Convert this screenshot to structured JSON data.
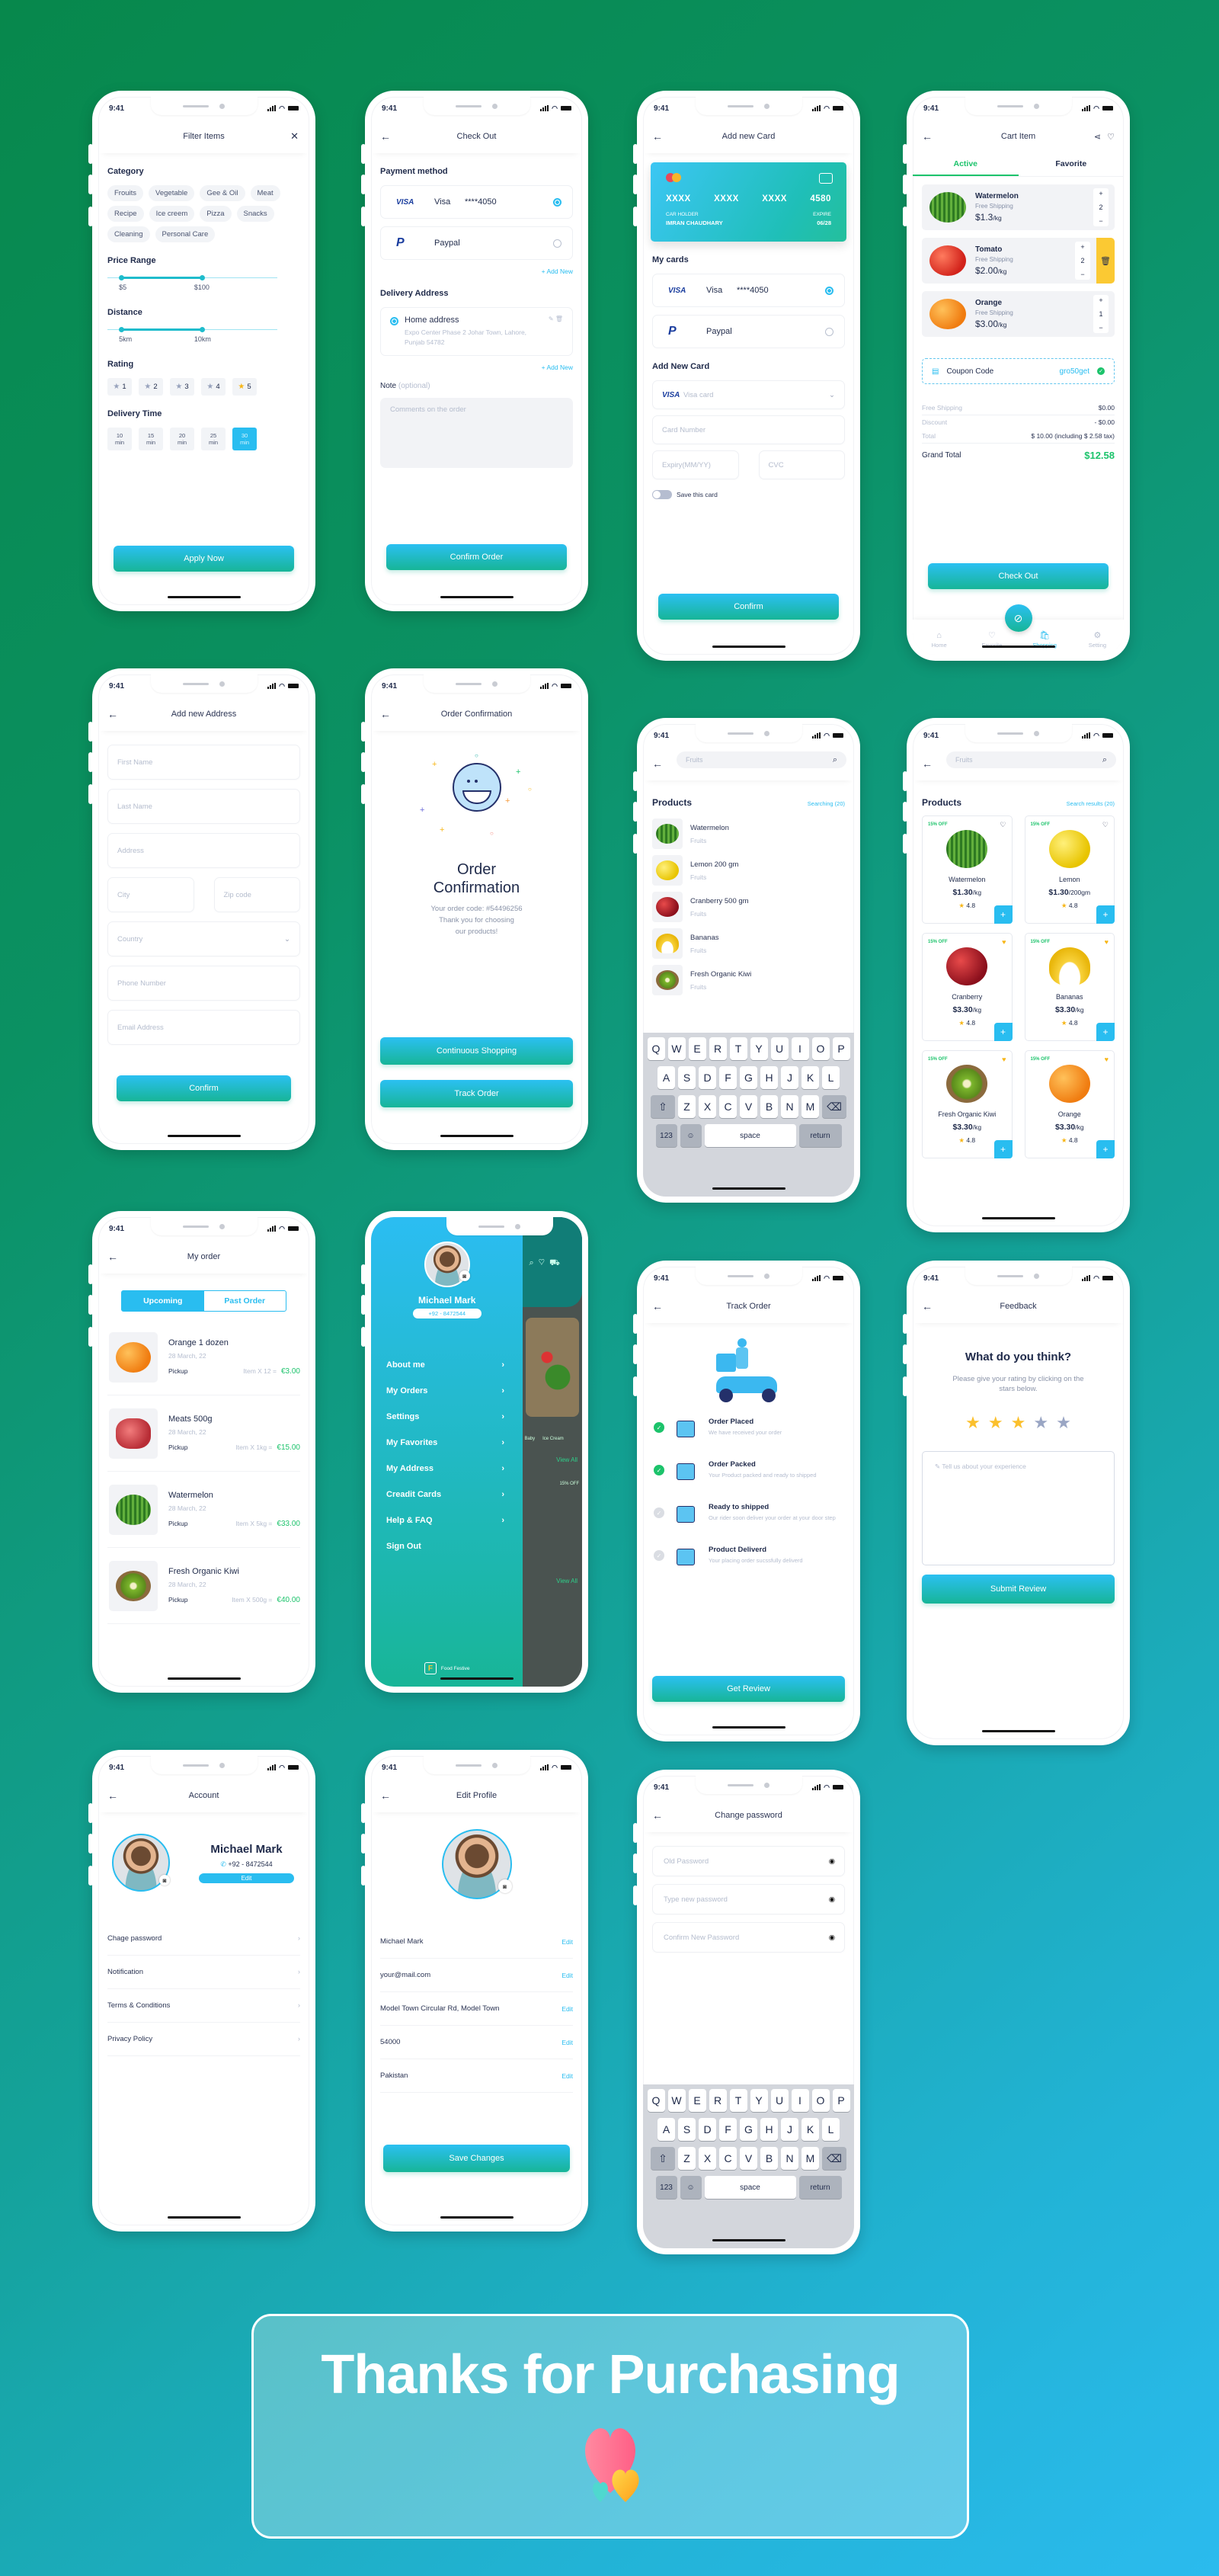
{
  "status": {
    "time": "9:41"
  },
  "colors": {
    "accent": "#29bdf0",
    "green": "#1cc36b",
    "button_top": "#2bc0f2",
    "button_bottom": "#17b597",
    "star": "#fbc02d",
    "background_start": "#07884c",
    "background_end": "#2bbbee"
  },
  "keyboard": {
    "rows": [
      [
        "Q",
        "W",
        "E",
        "R",
        "T",
        "Y",
        "U",
        "I",
        "O",
        "P"
      ],
      [
        "A",
        "S",
        "D",
        "F",
        "G",
        "H",
        "J",
        "K",
        "L"
      ],
      [
        "Z",
        "X",
        "C",
        "V",
        "B",
        "N",
        "M"
      ]
    ],
    "numbers": "123",
    "space": "space",
    "return": "return"
  },
  "filter": {
    "title": "Filter  Items",
    "category_label": "Category",
    "categories": [
      "Frouits",
      "Vegetable",
      "Gee & Oil",
      "Meat",
      "Recipe",
      "Ice creem",
      "Pizza",
      "Snacks",
      "Cleaning",
      "Personal Care"
    ],
    "price_label": "Price Range",
    "price_min": "$5",
    "price_max": "$100",
    "distance_label": "Distance",
    "distance_min": "5km",
    "distance_max": "10km",
    "rating_label": "Rating",
    "ratings": [
      {
        "value": "1",
        "on": false
      },
      {
        "value": "2",
        "on": false
      },
      {
        "value": "3",
        "on": false
      },
      {
        "value": "4",
        "on": false
      },
      {
        "value": "5",
        "on": true
      }
    ],
    "delivery_label": "Delivery Time",
    "times": [
      {
        "value": "10",
        "unit": "min",
        "on": false
      },
      {
        "value": "15",
        "unit": "min",
        "on": false
      },
      {
        "value": "20",
        "unit": "min",
        "on": false
      },
      {
        "value": "25",
        "unit": "min",
        "on": false
      },
      {
        "value": "30",
        "unit": "min",
        "on": true
      }
    ],
    "apply": "Apply Now"
  },
  "payment_methods": [
    {
      "brand": "VISA",
      "name": "Visa",
      "number": "****4050",
      "on": true
    },
    {
      "brand": "P",
      "name": "Paypal",
      "number": "",
      "on": false
    }
  ],
  "checkout": {
    "title": "Check Out",
    "payment_label": "Payment method",
    "add_new": "+ Add New",
    "delivery_label": "Delivery  Address",
    "address_name": "Home address",
    "address_line": "Expo Center Phase 2 Johar Town, Lahore, Punjab 54782",
    "note_label": "Note",
    "note_optional": "(optional)",
    "note_placeholder": "Comments on the order",
    "confirm": "Confirm Order"
  },
  "add_card": {
    "title": "Add new Card",
    "card_number": [
      "XXXX",
      "XXXX",
      "XXXX",
      "4580"
    ],
    "holder_label": "CAR HOLDER",
    "holder": "IMRAN CHAUDHARY",
    "expire_label": "EXPIRE",
    "expire": "06/28",
    "my_cards_label": "My cards",
    "add_new_label": "Add New Card",
    "card_type_brand": "VISA",
    "card_type_placeholder": "Visa card",
    "card_number_placeholder": "Card Number",
    "expiry_placeholder": "Expiry(MM/YY)",
    "cvc_placeholder": "CVC",
    "save_label": "Save this card",
    "save_on": false,
    "confirm": "Confirm"
  },
  "cart": {
    "title": "Cart Item",
    "tabs": [
      {
        "label": "Active",
        "on": true
      },
      {
        "label": "Favorite",
        "on": false
      }
    ],
    "items": [
      {
        "name": "Watermelon",
        "shipping": "Free Shipping",
        "price": "$1.3",
        "unit": "/kg",
        "qty": "2",
        "fruit": "watermelon"
      },
      {
        "name": "Tomato",
        "shipping": "Free Shipping",
        "price": "$2.00",
        "unit": "/kg",
        "qty": "2",
        "fruit": "tomato"
      },
      {
        "name": "Orange",
        "shipping": "Free Shipping",
        "price": "$3.00",
        "unit": "/kg",
        "qty": "1",
        "fruit": "orange"
      }
    ],
    "coupon_label": "Coupon Code",
    "coupon": "gro50get",
    "summary": [
      {
        "label": "Free Shipping",
        "value": "$0.00"
      },
      {
        "label": "Discount",
        "value": "- $0.00"
      },
      {
        "label": "Total",
        "value": "$ 10.00 (including $ 2.58 tax)"
      }
    ],
    "grand_label": "Grand Total",
    "grand_value": "$12.58",
    "checkout": "Check Out",
    "nav": [
      {
        "label": "Home",
        "icon": "home-icon",
        "on": false
      },
      {
        "label": "Favorite",
        "icon": "heart-icon",
        "on": false
      },
      {
        "label": "Shopping",
        "icon": "bag-icon",
        "on": true
      },
      {
        "label": "Setting",
        "icon": "gear-icon",
        "on": false
      }
    ]
  },
  "address": {
    "title": "Add new Address",
    "first_name": "First Name",
    "last_name": "Last Name",
    "address": "Address",
    "city": "City",
    "zip": "Zip code",
    "country": "Country",
    "phone": "Phone Number",
    "email": "Email Address",
    "confirm": "Confirm"
  },
  "order_confirmation": {
    "title": "Order Confirmation",
    "heading_1": "Order",
    "heading_2": "Confirmation",
    "code": "Your order code: #54496256",
    "thanks_1": "Thank you for choosing",
    "thanks_2": "our products!",
    "continue": "Continuous Shopping",
    "track": "Track Order"
  },
  "search_list": {
    "placeholder": "Fruits",
    "products_label": "Products",
    "count": "Searching  (20)",
    "items": [
      {
        "name": "Watermelon",
        "category": "Fruits",
        "fruit": "watermelon"
      },
      {
        "name": "Lemon 200 gm",
        "category": "Fruits",
        "fruit": "lemon"
      },
      {
        "name": "Cranberry 500 gm",
        "category": "Fruits",
        "fruit": "cherry"
      },
      {
        "name": "Bananas",
        "category": "Fruits",
        "fruit": "banana"
      },
      {
        "name": "Fresh Organic Kiwi",
        "category": "Fruits",
        "fruit": "kiwi"
      }
    ]
  },
  "search_grid": {
    "placeholder": "Fruits",
    "products_label": "Products",
    "count": "Search results (20)",
    "products": [
      {
        "discount": "15% OFF",
        "name": "Watermelon",
        "price": "$1.30",
        "unit": "/kg",
        "rating": "4.8",
        "fav": false,
        "fruit": "watermelon"
      },
      {
        "discount": "15% OFF",
        "name": "Lemon",
        "price": "$1.30",
        "unit": "/200gm",
        "rating": "4.8",
        "fav": false,
        "fruit": "lemon"
      },
      {
        "discount": "15% OFF",
        "name": "Cranberry",
        "price": "$3.30",
        "unit": "/kg",
        "rating": "4.8",
        "fav": true,
        "fruit": "cherry"
      },
      {
        "discount": "15% OFF",
        "name": "Bananas",
        "price": "$3.30",
        "unit": "/kg",
        "rating": "4.8",
        "fav": true,
        "fruit": "banana"
      },
      {
        "discount": "15% OFF",
        "name": "Fresh Organic Kiwi",
        "price": "$3.30",
        "unit": "/kg",
        "rating": "4.8",
        "fav": true,
        "fruit": "kiwi"
      },
      {
        "discount": "15% OFF",
        "name": "Orange",
        "price": "$3.30",
        "unit": "/kg",
        "rating": "4.8",
        "fav": true,
        "fruit": "orange"
      }
    ]
  },
  "my_order": {
    "title": "My order",
    "tabs": [
      {
        "label": "Upcoming",
        "on": true
      },
      {
        "label": "Past Order",
        "on": false
      }
    ],
    "orders": [
      {
        "name": "Orange 1 dozen",
        "date": "28 March, 22",
        "method": "Pickup",
        "qty": "Item X 12 =",
        "price": "€3.00",
        "fruit": "orange"
      },
      {
        "name": "Meats 500g",
        "date": "28 March, 22",
        "method": "Pickup",
        "qty": "Item X 1kg =",
        "price": "€15.00",
        "fruit": "meat"
      },
      {
        "name": "Watermelon",
        "date": "28 March, 22",
        "method": "Pickup",
        "qty": "Item X 5kg =",
        "price": "€33.00",
        "fruit": "watermelon"
      },
      {
        "name": "Fresh Organic Kiwi",
        "date": "28 March, 22",
        "method": "Pickup",
        "qty": "Item X 500g =",
        "price": "€40.00",
        "fruit": "kiwi"
      }
    ]
  },
  "drawer": {
    "name": "Michael Mark",
    "phone": "+92 - 8472544",
    "menu": [
      {
        "label": "About me",
        "arrow": true
      },
      {
        "label": "My Orders",
        "arrow": true
      },
      {
        "label": "Settings",
        "arrow": true
      },
      {
        "label": "My Favorites",
        "arrow": true
      },
      {
        "label": "My Address",
        "arrow": true
      },
      {
        "label": "Creadit Cards",
        "arrow": true
      },
      {
        "label": "Help & FAQ",
        "arrow": true
      },
      {
        "label": "Sign Out",
        "arrow": false
      }
    ],
    "brand": "Food Festive",
    "behind": {
      "baby": "Baby",
      "ice_cream": "Ice Cream",
      "view_all": "View All",
      "discount": "15% OFF"
    }
  },
  "track": {
    "title": "Track Order",
    "steps": [
      {
        "title": "Order Placed",
        "desc": "We have received your order",
        "done": true
      },
      {
        "title": "Order Packed",
        "desc": "Your Product packed and ready to shipped",
        "done": true
      },
      {
        "title": "Ready to shipped",
        "desc": "Our rider soon deliver your order at your door step",
        "done": false
      },
      {
        "title": "Product Deliverd",
        "desc": "Your placing order sucssfully deliverd",
        "done": false
      }
    ],
    "button": "Get Review"
  },
  "feedback": {
    "title": "Feedback",
    "heading": "What do you think?",
    "subtitle": "Please give your rating by clicking on the stars below.",
    "rating": 3,
    "rating_max": 5,
    "placeholder": "Tell us about your experience",
    "submit": "Submit Review"
  },
  "account": {
    "title": "Account",
    "name": "Michael Mark",
    "phone": "+92 - 8472544",
    "edit": "Edit",
    "menu": [
      "Chage password",
      "Notification",
      "Terms & Conditions",
      "Privacy Policy"
    ]
  },
  "edit_profile": {
    "title": "Edit Profile",
    "edit_label": "Edit",
    "fields": [
      "Michael Mark",
      "your@mail.com",
      "Model Town Circular Rd, Model Town",
      "54000",
      "Pakistan"
    ],
    "save": "Save Changes"
  },
  "change_password": {
    "title": "Change password",
    "fields": [
      "Old Password",
      "Type new password",
      "Confirm New Password"
    ]
  },
  "banner": {
    "text": "Thanks for Purchasing"
  }
}
